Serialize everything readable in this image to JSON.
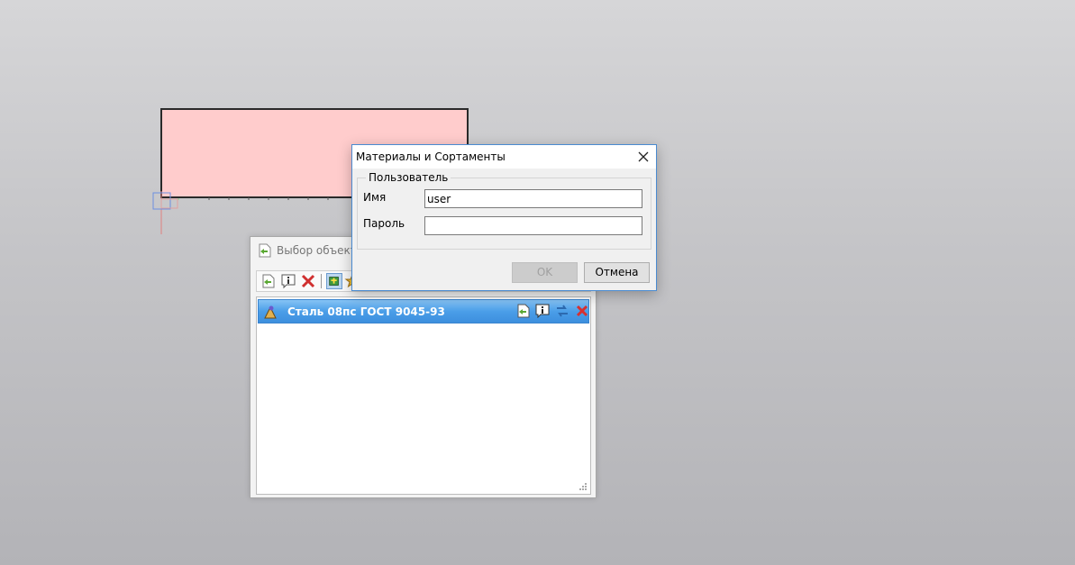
{
  "background_window": {
    "title": "Выбор объекта",
    "toolbar_icons": [
      "add-icon",
      "info-icon",
      "delete-icon",
      "materials-icon",
      "star-icon"
    ],
    "list": [
      {
        "label": "Сталь 08пс ГОСТ 9045-93",
        "icon": "material-icon",
        "actions": [
          "open-icon",
          "info-icon",
          "replace-icon",
          "delete-icon"
        ],
        "selected": true
      }
    ]
  },
  "dialog": {
    "title": "Материалы и Сортаменты",
    "group_label": "Пользователь",
    "name_label": "Имя",
    "name_value": "user",
    "password_label": "Пароль",
    "password_value": "",
    "ok_label": "OK",
    "cancel_label": "Отмена"
  },
  "colors": {
    "sketch_fill": "#ffcccc",
    "selection_blue": "#4a9ee8",
    "dialog_border": "#4a8bd1"
  }
}
